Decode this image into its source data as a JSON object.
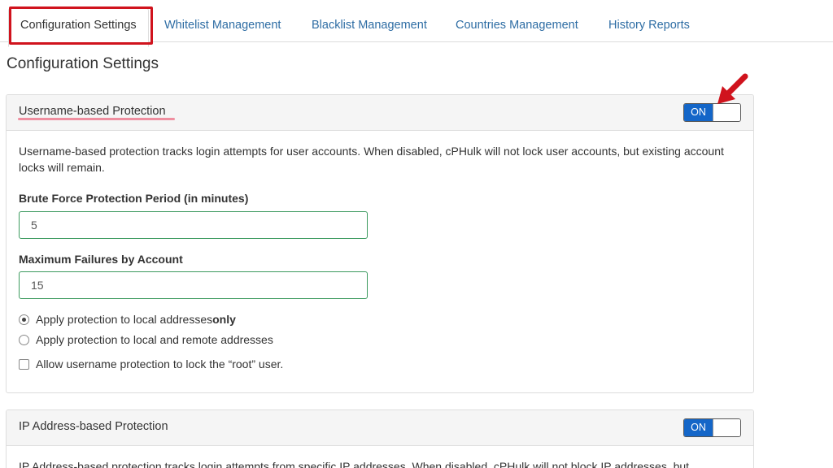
{
  "tabs": [
    {
      "label": "Configuration Settings"
    },
    {
      "label": "Whitelist Management"
    },
    {
      "label": "Blacklist Management"
    },
    {
      "label": "Countries Management"
    },
    {
      "label": "History Reports"
    }
  ],
  "page_title": "Configuration Settings",
  "username_panel": {
    "title": "Username-based Protection",
    "toggle_label": "ON",
    "description": "Username-based protection tracks login attempts for user accounts. When disabled, cPHulk will not lock user accounts, but existing account locks will remain.",
    "period_label": "Brute Force Protection Period (in minutes)",
    "period_value": "5",
    "max_failures_label": "Maximum Failures by Account",
    "max_failures_value": "15",
    "radio_local_prefix": "Apply protection to local addresses ",
    "radio_local_bold": "only",
    "radio_remote": "Apply protection to local and remote addresses",
    "checkbox_root": "Allow username protection to lock the “root” user."
  },
  "ip_panel": {
    "title": "IP Address-based Protection",
    "toggle_label": "ON",
    "description": "IP Address-based protection tracks login attempts from specific IP addresses. When disabled, cPHulk will not block IP addresses, but"
  },
  "colors": {
    "link": "#2e6da4",
    "toggle_on": "#1466c8",
    "annotation_red": "#d0131d",
    "annotation_underline": "#ef8fa0",
    "input_border": "#3c9a5f"
  }
}
